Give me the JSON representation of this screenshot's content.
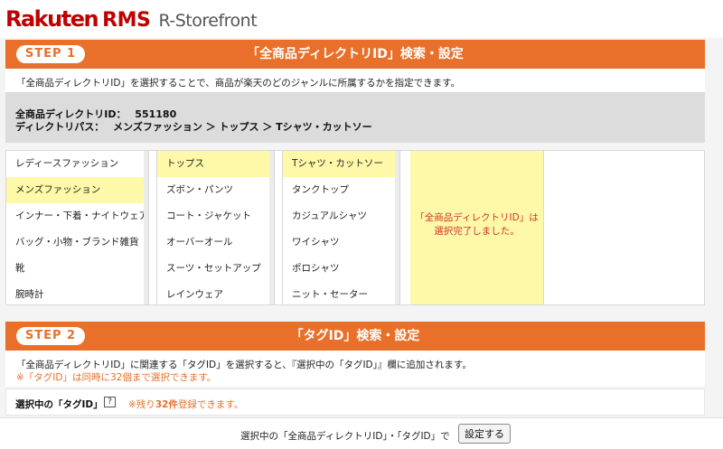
{
  "header": {
    "brand": "Rakuten",
    "product": "RMS",
    "subtitle": "R-Storefront"
  },
  "step1": {
    "badge": "STEP 1",
    "title": "「全商品ディレクトリID」検索・設定",
    "description": "「全商品ディレクトリID」を選択することで、商品が楽天のどのジャンルに所属するかを指定できます。",
    "directory_id_label": "全商品ディレクトリID：",
    "directory_id_value": "551180",
    "directory_path_label": "ディレクトリパス：",
    "directory_path_value": "メンズファッション ＞ トップス ＞ Tシャツ・カットソー"
  },
  "columns": [
    {
      "items": [
        {
          "label": "レディースファッション",
          "selected": false
        },
        {
          "label": "メンズファッション",
          "selected": true
        },
        {
          "label": "インナー・下着・ナイトウェア",
          "selected": false
        },
        {
          "label": "バッグ・小物・ブランド雑貨",
          "selected": false
        },
        {
          "label": "靴",
          "selected": false
        },
        {
          "label": "腕時計",
          "selected": false
        }
      ]
    },
    {
      "items": [
        {
          "label": "トップス",
          "selected": true
        },
        {
          "label": "ズボン・パンツ",
          "selected": false
        },
        {
          "label": "コート・ジャケット",
          "selected": false
        },
        {
          "label": "オーバーオール",
          "selected": false
        },
        {
          "label": "スーツ・セットアップ",
          "selected": false
        },
        {
          "label": "レインウェア",
          "selected": false
        }
      ]
    },
    {
      "items": [
        {
          "label": "Tシャツ・カットソー",
          "selected": true
        },
        {
          "label": "タンクトップ",
          "selected": false
        },
        {
          "label": "カジュアルシャツ",
          "selected": false
        },
        {
          "label": "ワイシャツ",
          "selected": false
        },
        {
          "label": "ポロシャツ",
          "selected": false
        },
        {
          "label": "ニット・セーター",
          "selected": false
        }
      ]
    }
  ],
  "completion": {
    "line1": "「全商品ディレクトリID」は",
    "line2": "選択完了しました。"
  },
  "step2": {
    "badge": "STEP 2",
    "title": "「タグID」検索・設定",
    "description": "「全商品ディレクトリID」に関連する「タグID」を選択すると、『選択中の「タグID」』欄に追加されます。",
    "warning": "※「タグID」は同時に32個まで選択できます。",
    "selected_label": "選択中の「タグID」",
    "help_icon": "?",
    "remaining_prefix": "※残り",
    "remaining_count": "32件",
    "remaining_suffix": "登録できます。"
  },
  "footer": {
    "text": "選択中の「全商品ディレクトリID」・「タグID」で",
    "button": "設定する"
  },
  "colors": {
    "brand_red": "#bf0000",
    "step_orange": "#e8702a",
    "selected_yellow": "#fdf9a8",
    "complete_red": "#d6322a"
  }
}
